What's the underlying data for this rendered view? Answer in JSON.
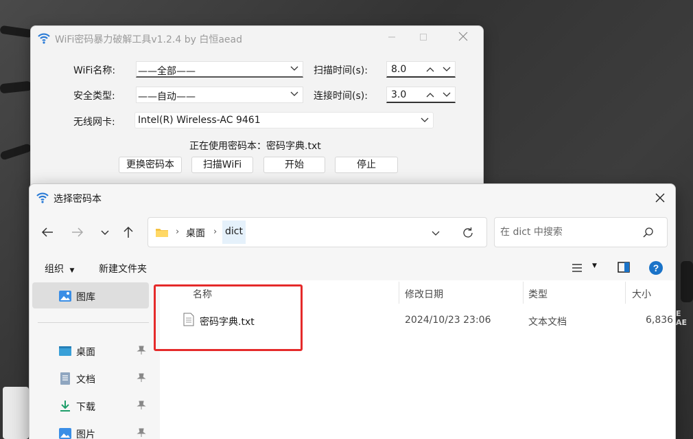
{
  "app": {
    "title": "WiFi密码暴力破解工具v1.2.4 by 白恒aead",
    "wifi_name_label": "WiFi名称:",
    "wifi_name_value": "——全部——",
    "security_label": "安全类型:",
    "security_value": "——自动——",
    "card_label": "无线网卡:",
    "card_value": "Intel(R) Wireless-AC 9461",
    "scan_time_label": "扫描时间(s):",
    "scan_time_value": "8.0",
    "connect_time_label": "连接时间(s):",
    "connect_time_value": "3.0",
    "status_text": "正在使用密码本：密码字典.txt",
    "buttons": {
      "change_dict": "更换密码本",
      "scan": "扫描WiFi",
      "start": "开始",
      "stop": "停止"
    }
  },
  "dialog": {
    "title": "选择密码本",
    "breadcrumb": [
      "桌面",
      "dict"
    ],
    "search_placeholder": "在 dict 中搜索",
    "toolbar": {
      "organize": "组织",
      "new_folder": "新建文件夹"
    },
    "sidebar": [
      {
        "label": "图库",
        "icon": "gallery-icon",
        "pinned": false,
        "selected": true
      },
      {
        "label": "桌面",
        "icon": "desktop-icon",
        "pinned": true,
        "selected": false
      },
      {
        "label": "文档",
        "icon": "documents-icon",
        "pinned": true,
        "selected": false
      },
      {
        "label": "下载",
        "icon": "download-icon",
        "pinned": true,
        "selected": false
      },
      {
        "label": "图片",
        "icon": "pictures-icon",
        "pinned": true,
        "selected": false
      }
    ],
    "columns": {
      "name": "名称",
      "modified": "修改日期",
      "type": "类型",
      "size": "大小"
    },
    "files": [
      {
        "name": "密码字典.txt",
        "modified": "2024/10/23 23:06",
        "type": "文本文档",
        "size": "6,836"
      }
    ]
  },
  "desktop": {
    "edge_text": "E AE"
  },
  "colors": {
    "highlight_box": "#e52a2a",
    "selected_crumb": "#e5f1fb",
    "accent_blue": "#1a73c8"
  }
}
